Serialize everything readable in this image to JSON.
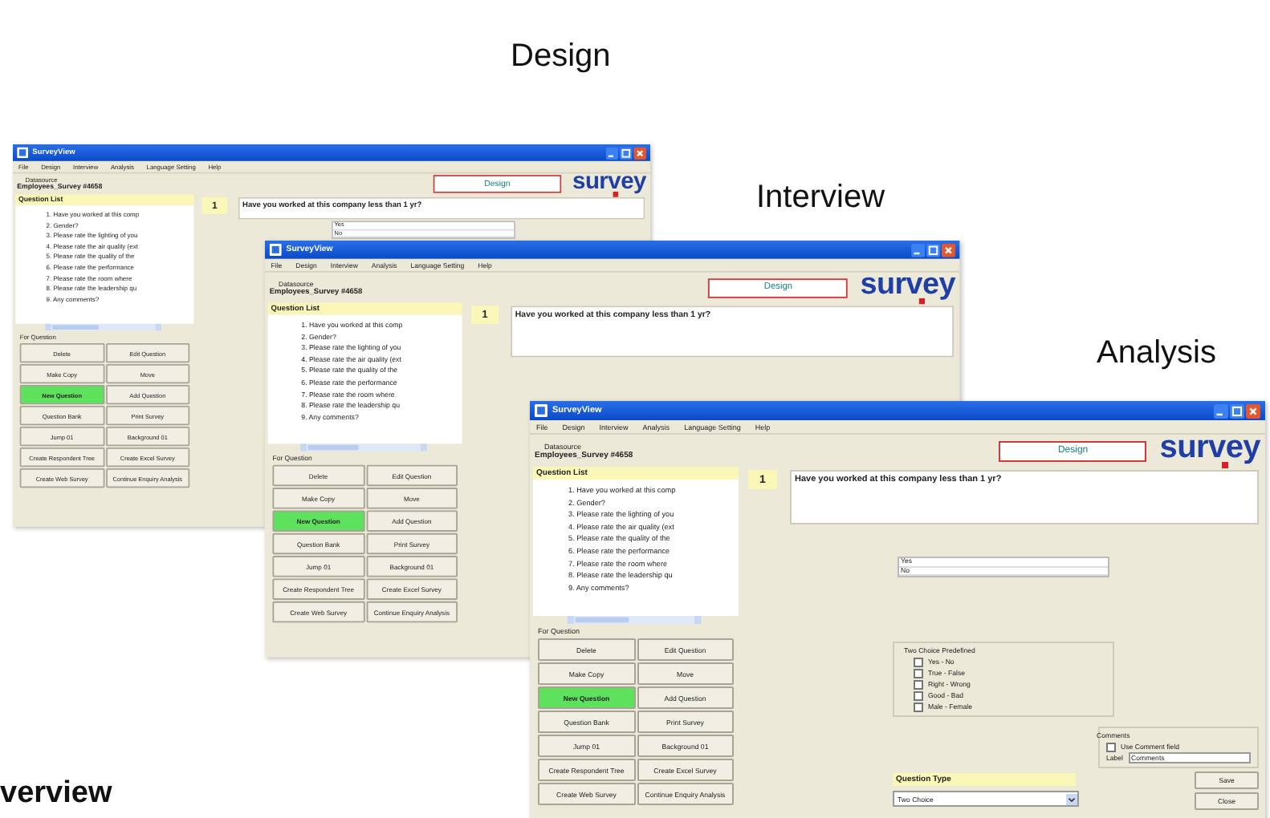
{
  "labels": [
    {
      "text": "Design"
    },
    {
      "text": "Interview"
    },
    {
      "text": "Analysis"
    }
  ],
  "heading": "verview",
  "windows": [
    {
      "title": "SurveyView",
      "menu": [
        "File",
        "Design",
        "Interview",
        "Analysis",
        "Language Setting",
        "Help"
      ],
      "datasource_label": "Datasource",
      "survey_name": "Employees_Survey #4658",
      "mode": "Design",
      "logo": "survey",
      "question_list": {
        "title": "Question List",
        "items": [
          "1. Have you worked at this comp",
          "2. Gender?",
          "3. Please rate the lighting of you",
          "4. Please rate the air quality (ext",
          "5. Please rate the quality of the",
          "6. Please rate the performance",
          "7. Please rate the room where",
          "8. Please rate the leadership qu",
          "9. Any comments?"
        ]
      },
      "for_question_label": "For Question",
      "buttons": [
        {
          "label": "Delete",
          "highlighted": false
        },
        {
          "label": "Edit Question",
          "highlighted": false
        },
        {
          "label": "Make Copy",
          "highlighted": false
        },
        {
          "label": "Move",
          "highlighted": false
        },
        {
          "label": "New Question",
          "highlighted": true
        },
        {
          "label": "Add Question",
          "highlighted": false
        },
        {
          "label": "Question Bank",
          "highlighted": false
        },
        {
          "label": "Print Survey",
          "highlighted": false
        },
        {
          "label": "Jump 01",
          "highlighted": false
        },
        {
          "label": "Background 01",
          "highlighted": false
        },
        {
          "label": "Create Respondent Tree",
          "highlighted": false
        },
        {
          "label": "Create Excel Survey",
          "highlighted": false
        },
        {
          "label": "Create Web Survey",
          "highlighted": false
        },
        {
          "label": "Continue Enquiry Analysis",
          "highlighted": false
        }
      ],
      "question": {
        "number": "1",
        "text": "Have you worked at this company less than 1 yr?"
      },
      "answers": [
        "Yes",
        "No"
      ]
    },
    {
      "title": "SurveyView",
      "menu": [
        "File",
        "Design",
        "Interview",
        "Analysis",
        "Language Setting",
        "Help"
      ],
      "datasource_label": "Datasource",
      "survey_name": "Employees_Survey #4658",
      "mode": "Design",
      "logo": "survey",
      "question_list": {
        "title": "Question List",
        "items": [
          "1. Have you worked at this comp",
          "2. Gender?",
          "3. Please rate the lighting of you",
          "4. Please rate the air quality (ext",
          "5. Please rate the quality of the",
          "6. Please rate the performance",
          "7. Please rate the room where",
          "8. Please rate the leadership qu",
          "9. Any comments?"
        ]
      },
      "for_question_label": "For Question",
      "buttons": [
        {
          "label": "Delete",
          "highlighted": false
        },
        {
          "label": "Edit Question",
          "highlighted": false
        },
        {
          "label": "Make Copy",
          "highlighted": false
        },
        {
          "label": "Move",
          "highlighted": false
        },
        {
          "label": "New Question",
          "highlighted": true
        },
        {
          "label": "Add Question",
          "highlighted": false
        },
        {
          "label": "Question Bank",
          "highlighted": false
        },
        {
          "label": "Print Survey",
          "highlighted": false
        },
        {
          "label": "Jump 01",
          "highlighted": false
        },
        {
          "label": "Background 01",
          "highlighted": false
        },
        {
          "label": "Create Respondent Tree",
          "highlighted": false
        },
        {
          "label": "Create Excel Survey",
          "highlighted": false
        },
        {
          "label": "Create Web Survey",
          "highlighted": false
        },
        {
          "label": "Continue Enquiry Analysis",
          "highlighted": false
        }
      ],
      "question": {
        "number": "1",
        "text": "Have you worked at this company less than 1 yr?"
      }
    },
    {
      "title": "SurveyView",
      "menu": [
        "File",
        "Design",
        "Interview",
        "Analysis",
        "Language Setting",
        "Help"
      ],
      "datasource_label": "Datasource",
      "survey_name": "Employees_Survey #4658",
      "mode": "Design",
      "logo": "survey",
      "question_list": {
        "title": "Question List",
        "items": [
          "1. Have you worked at this comp",
          "2. Gender?",
          "3. Please rate the lighting of you",
          "4. Please rate the air quality (ext",
          "5. Please rate the quality of the",
          "6. Please rate the performance",
          "7. Please rate the room where",
          "8. Please rate the leadership qu",
          "9. Any comments?"
        ]
      },
      "for_question_label": "For Question",
      "buttons": [
        {
          "label": "Delete",
          "highlighted": false
        },
        {
          "label": "Edit Question",
          "highlighted": false
        },
        {
          "label": "Make Copy",
          "highlighted": false
        },
        {
          "label": "Move",
          "highlighted": false
        },
        {
          "label": "New Question",
          "highlighted": true
        },
        {
          "label": "Add Question",
          "highlighted": false
        },
        {
          "label": "Question Bank",
          "highlighted": false
        },
        {
          "label": "Print Survey",
          "highlighted": false
        },
        {
          "label": "Jump 01",
          "highlighted": false
        },
        {
          "label": "Background 01",
          "highlighted": false
        },
        {
          "label": "Create Respondent Tree",
          "highlighted": false
        },
        {
          "label": "Create Excel Survey",
          "highlighted": false
        },
        {
          "label": "Create Web Survey",
          "highlighted": false
        },
        {
          "label": "Continue Enquiry Analysis",
          "highlighted": false
        }
      ],
      "question": {
        "number": "1",
        "text": "Have you worked at this company less than 1 yr?"
      },
      "answers": [
        "Yes",
        "No"
      ],
      "predefined": {
        "title": "Two Choice Predefined",
        "options": [
          {
            "label": "Yes - No",
            "checked": false
          },
          {
            "label": "True - False",
            "checked": false
          },
          {
            "label": "Right - Wrong",
            "checked": false
          },
          {
            "label": "Good - Bad",
            "checked": false
          },
          {
            "label": "Male - Female",
            "checked": false
          }
        ]
      },
      "comments": {
        "title": "Comments",
        "option": {
          "label": "Use Comment field",
          "checked": false
        },
        "label_caption": "Label",
        "label_value": "Comments"
      },
      "question_type": {
        "title": "Question Type",
        "value": "Two Choice"
      },
      "actions": [
        "Save",
        "Close"
      ]
    }
  ]
}
